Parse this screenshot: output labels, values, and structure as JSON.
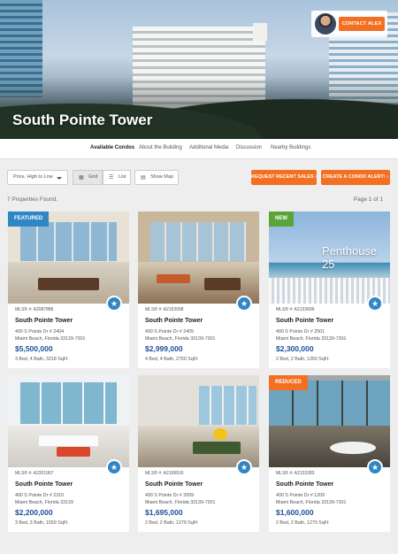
{
  "hero": {
    "title": "South Pointe Tower",
    "contact_label": "CONTACT ALEX"
  },
  "nav": {
    "items": [
      {
        "label": "Available Condos",
        "active": true
      },
      {
        "label": "About the Building",
        "active": false
      },
      {
        "label": "Additional Media",
        "active": false
      },
      {
        "label": "Discussion",
        "active": false
      },
      {
        "label": "Nearby Buildings",
        "active": false
      }
    ]
  },
  "toolbar": {
    "sort_label": "Price, High to Low",
    "grid_label": "Grid",
    "list_label": "List",
    "map_label": "Show Map",
    "request_label": "REQUEST RECENT SALES",
    "alert_label": "CREATE A CONDO ALERT!"
  },
  "results": {
    "found": "7 Properties Found.",
    "pages": "Page 1 of 1"
  },
  "colors": {
    "accent": "#f36f21",
    "price": "#1f4f9a",
    "fav": "#2f86c5",
    "badge_featured": "#2f86c5",
    "badge_new": "#5aa53a",
    "badge_reduced": "#f36f21"
  },
  "listings": [
    {
      "badge": "FEATURED",
      "mls": "MLS® #: A2087886",
      "name": "South Pointe Tower",
      "addr1": "400 S Pointe Dr # 2404",
      "addr2": "Miami Beach, Florida 33139-7301",
      "price": "$5,500,000",
      "specs": "3 Bed, 4 Bath, 3218 SqFt"
    },
    {
      "badge": "",
      "mls": "MLS® #: A2193098",
      "name": "South Pointe Tower",
      "addr1": "400 S Pointe Dr # 2405",
      "addr2": "Miami Beach, Florida 33139-7301",
      "price": "$2,999,000",
      "specs": "4 Bed, 4 Bath, 2750 SqFt"
    },
    {
      "badge": "NEW",
      "overlay": "Penthouse 25",
      "mls": "MLS® #: A2133699",
      "name": "South Pointe Tower",
      "addr1": "400 S Pointe Dr # 2501",
      "addr2": "Miami Beach, Florida 33139-7301",
      "price": "$2,300,000",
      "specs": "2 Bed, 2 Bath, 1350 SqFt"
    },
    {
      "badge": "",
      "mls": "MLS® #: A2201967",
      "name": "South Pointe Tower",
      "addr1": "400 S Pointe Dr # 2310",
      "addr2": "Miami Beach, Florida 33139",
      "price": "$2,200,000",
      "specs": "3 Bed, 3 Bath, 1559 SqFt"
    },
    {
      "badge": "",
      "mls": "MLS® #: A2199916",
      "name": "South Pointe Tower",
      "addr1": "400 S Pointe Dr # 2009",
      "addr2": "Miami Beach, Florida 33139-7301",
      "price": "$1,695,000",
      "specs": "2 Bed, 2 Bath, 1279 SqFt"
    },
    {
      "badge": "REDUCED",
      "mls": "MLS® #: A2133283",
      "name": "South Pointe Tower",
      "addr1": "400 S Pointe Dr # 1209",
      "addr2": "Miami Beach, Florida 33139-7301",
      "price": "$1,600,000",
      "specs": "2 Bed, 2 Bath, 1279 SqFt"
    }
  ]
}
